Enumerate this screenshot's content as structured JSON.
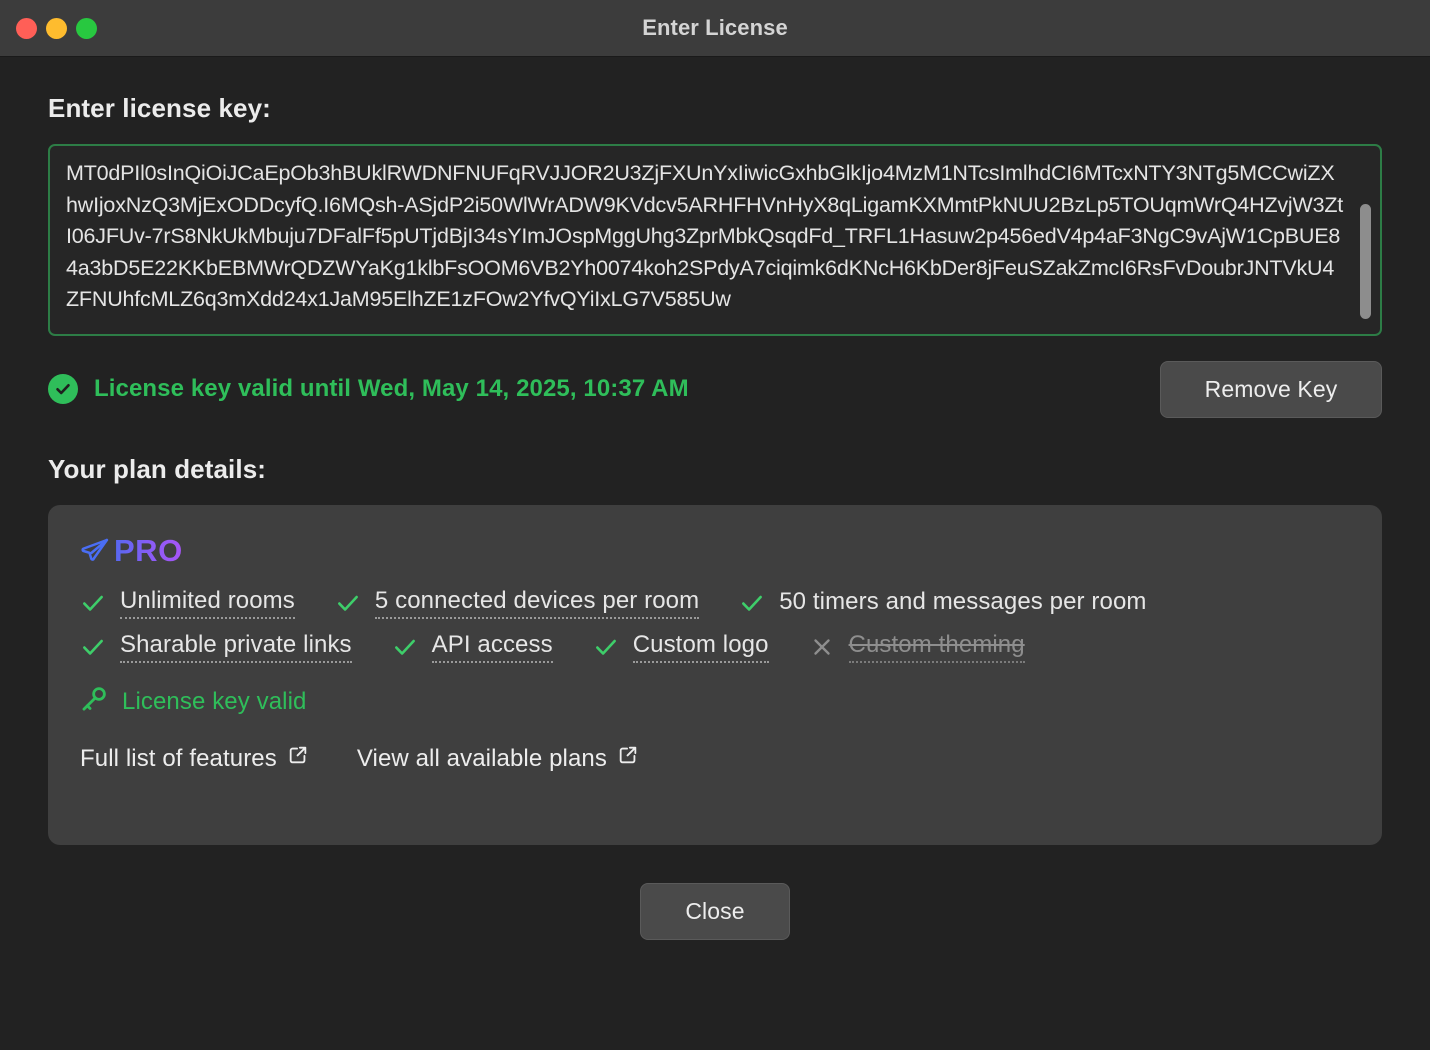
{
  "window": {
    "title": "Enter License",
    "traffic_lights": [
      {
        "name": "close",
        "color": "#ff5f57"
      },
      {
        "name": "minimize",
        "color": "#febc2e"
      },
      {
        "name": "maximize",
        "color": "#28c840"
      }
    ]
  },
  "license": {
    "heading": "Enter license key:",
    "key_value": "MT0dPIl0sInQiOiJCaEpOb3hBUklRWDNFNUFqRVJJOR2U3ZjFXUnYxIiwicGxhbGlkIjo4MzM1NTcsImlhdCI6MTcxNTY3NTg5MCCwiZXhwIjoxNzQ3MjExODDcyfQ.I6MQsh-ASjdP2i50WlWrADW9KVdcv5ARHFHVnHyX8qLigamKXMmtPkNUU2BzLp5TOUqmWrQ4HZvjW3ZtI06JFUv-7rS8NkUkMbuju7DFalFf5pUTjdBjI34sYImJOspMggUhg3ZprMbkQsqdFd_TRFL1Hasuw2p456edV4p4aF3NgC9vAjW1CpBUE84a3bD5E22KKbEBMWrQDZWYaKg1klbFsOOM6VB2Yh0074koh2SPdyA7ciqimk6dKNcH6KbDer8jFeuSZakZmcI6RsFvDoubrJNTVkU4ZFNUhfcMLZ6q3mXdd24x1JaM95ElhZE1zFOw2YfvQYiIxLG7V585Uw",
    "status_text": "License key valid until Wed, May 14, 2025, 10:37 AM",
    "status_icon": "check-circle-icon",
    "status_color": "#2fbe5a",
    "remove_button_label": "Remove Key"
  },
  "plan": {
    "heading": "Your plan details:",
    "badge_icon": "paper-plane-icon",
    "badge_label": "PRO",
    "badge_gradient_start": "#5668f0",
    "badge_gradient_end": "#a855f7",
    "features": [
      [
        {
          "icon": "check-icon",
          "label": "Unlimited rooms",
          "enabled": true,
          "dotted": true
        },
        {
          "icon": "check-icon",
          "label": "5 connected devices per room",
          "enabled": true,
          "dotted": true
        },
        {
          "icon": "check-icon",
          "label": "50 timers and messages per room",
          "enabled": true,
          "dotted": false
        }
      ],
      [
        {
          "icon": "check-icon",
          "label": "Sharable private links",
          "enabled": true,
          "dotted": true
        },
        {
          "icon": "check-icon",
          "label": "API access",
          "enabled": true,
          "dotted": true
        },
        {
          "icon": "check-icon",
          "label": "Custom logo",
          "enabled": true,
          "dotted": true
        },
        {
          "icon": "cross-icon",
          "label": "Custom theming",
          "enabled": false,
          "dotted": true
        }
      ]
    ],
    "key_status": {
      "icon": "key-icon",
      "label": "License key valid",
      "color": "#2fbe5a"
    },
    "links": [
      {
        "label": "Full list of features",
        "icon": "external-link-icon"
      },
      {
        "label": "View all available plans",
        "icon": "external-link-icon"
      }
    ]
  },
  "footer": {
    "close_label": "Close"
  }
}
